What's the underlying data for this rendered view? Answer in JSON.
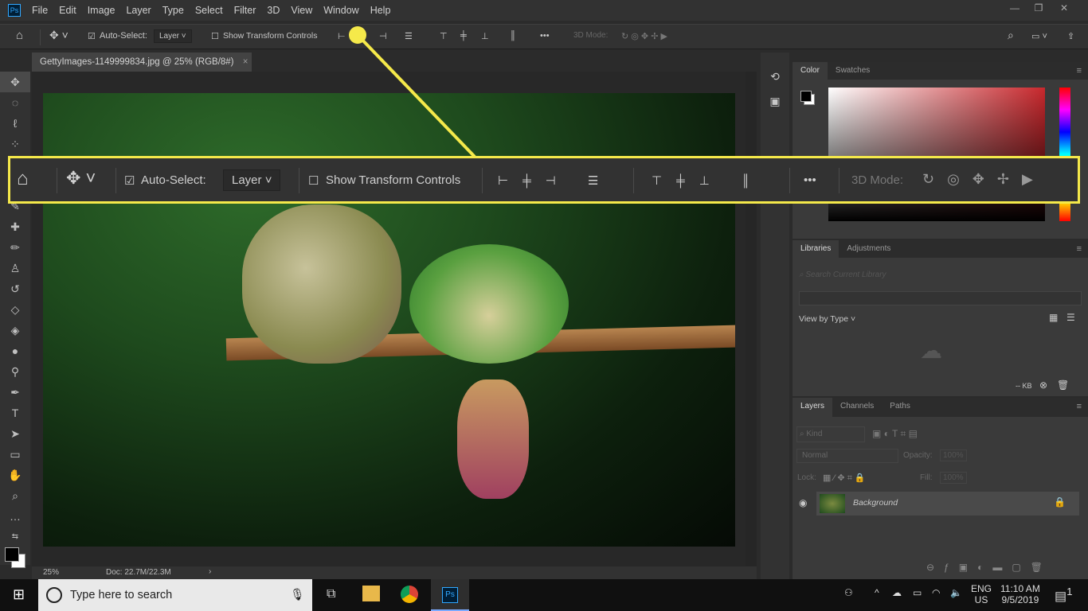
{
  "app": {
    "logo": "Ps",
    "menu": [
      "File",
      "Edit",
      "Image",
      "Layer",
      "Type",
      "Select",
      "Filter",
      "3D",
      "View",
      "Window",
      "Help"
    ],
    "window_controls": [
      "minimize",
      "restore",
      "close"
    ]
  },
  "options_bar": {
    "auto_select_label": "Auto-Select:",
    "auto_select_checked": true,
    "layer_select": "Layer",
    "show_transform_label": "Show Transform Controls",
    "show_transform_checked": false,
    "more": "•••",
    "mode_3d_label": "3D Mode:"
  },
  "document": {
    "tab_title": "GettyImages-1149999834.jpg @ 25% (RGB/8#)",
    "close": "×"
  },
  "status": {
    "zoom": "25%",
    "doc": "Doc: 22.7M/22.3M",
    "arrow": "›"
  },
  "color_panel": {
    "tabs": [
      "Color",
      "Swatches"
    ],
    "accent": "#c8282d"
  },
  "libraries_panel": {
    "tabs": [
      "Libraries",
      "Adjustments"
    ],
    "search_placeholder": "Search Current Library",
    "view_by": "View by Type",
    "size": "-- KB"
  },
  "layers_panel": {
    "tabs": [
      "Layers",
      "Channels",
      "Paths"
    ],
    "kind": "Kind",
    "blend": "Normal",
    "opacity_label": "Opacity:",
    "opacity": "100%",
    "lock_label": "Lock:",
    "fill_label": "Fill:",
    "fill": "100%",
    "layers": [
      {
        "name": "Background",
        "visible": true,
        "locked": true
      }
    ]
  },
  "taskbar": {
    "search_placeholder": "Type here to search",
    "lang1": "ENG",
    "lang2": "US",
    "time": "11:10 AM",
    "date": "9/5/2019",
    "notifications": "1"
  },
  "callout": {
    "color": "#f5e94a"
  }
}
